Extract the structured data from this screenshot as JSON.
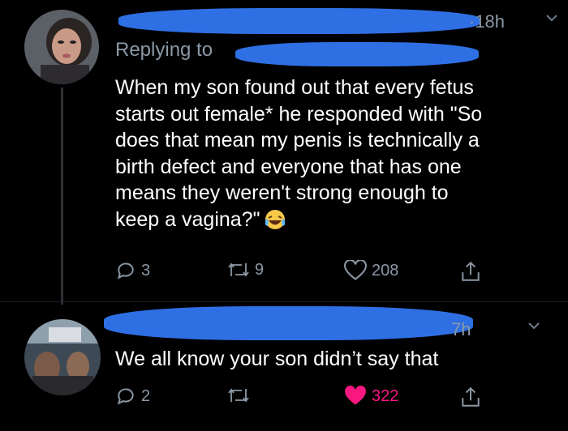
{
  "tweet1": {
    "time": "·18h",
    "replying_to": "Replying to",
    "text": "When my son found out that every fetus\nstarts out female* he responded with \"So\ndoes that mean my penis is technically a\nbirth defect and everyone that has one\nmeans they weren't strong enough to\nkeep a vagina?\"",
    "emoji": "face-with-tears-of-joy",
    "replies": "3",
    "retweets": "9",
    "likes": "208"
  },
  "tweet2": {
    "time": "7h",
    "text": "We all know your son didn’t say that",
    "replies": "2",
    "retweets": "",
    "likes": "322",
    "liked": true
  },
  "colors": {
    "background": "#000000",
    "muted": "#8b98a5",
    "redaction": "#2f6fe4",
    "like_active": "#f91880"
  }
}
